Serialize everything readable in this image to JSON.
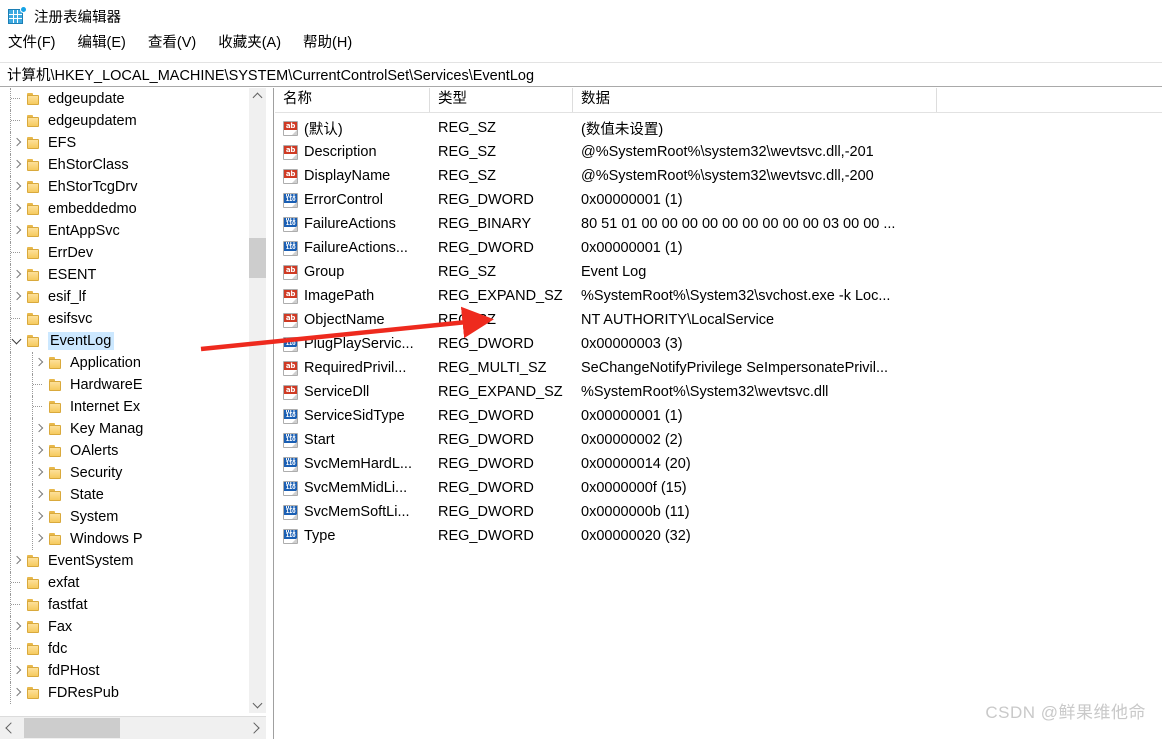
{
  "window": {
    "title": "注册表编辑器",
    "icon": "registry-editor-icon"
  },
  "menubar": {
    "items": [
      {
        "label": "文件(F)",
        "accel": "F"
      },
      {
        "label": "编辑(E)",
        "accel": "E"
      },
      {
        "label": "查看(V)",
        "accel": "V"
      },
      {
        "label": "收藏夹(A)",
        "accel": "A"
      },
      {
        "label": "帮助(H)",
        "accel": "H"
      }
    ]
  },
  "address": {
    "path": "计算机\\HKEY_LOCAL_MACHINE\\SYSTEM\\CurrentControlSet\\Services\\EventLog"
  },
  "tree": {
    "nodes": [
      {
        "label": "edgeupdate",
        "indent": 1,
        "state": "leaf",
        "selected": false
      },
      {
        "label": "edgeupdatem",
        "indent": 1,
        "state": "leaf",
        "selected": false
      },
      {
        "label": "EFS",
        "indent": 1,
        "state": "collapsed",
        "selected": false
      },
      {
        "label": "EhStorClass",
        "indent": 1,
        "state": "collapsed",
        "selected": false
      },
      {
        "label": "EhStorTcgDrv",
        "indent": 1,
        "state": "collapsed",
        "selected": false
      },
      {
        "label": "embeddedmo",
        "indent": 1,
        "state": "collapsed",
        "selected": false
      },
      {
        "label": "EntAppSvc",
        "indent": 1,
        "state": "collapsed",
        "selected": false
      },
      {
        "label": "ErrDev",
        "indent": 1,
        "state": "leaf",
        "selected": false
      },
      {
        "label": "ESENT",
        "indent": 1,
        "state": "collapsed",
        "selected": false
      },
      {
        "label": "esif_lf",
        "indent": 1,
        "state": "collapsed",
        "selected": false
      },
      {
        "label": "esifsvc",
        "indent": 1,
        "state": "leaf",
        "selected": false
      },
      {
        "label": "EventLog",
        "indent": 1,
        "state": "expanded",
        "selected": true
      },
      {
        "label": "Application",
        "indent": 2,
        "state": "collapsed",
        "selected": false
      },
      {
        "label": "HardwareE",
        "indent": 2,
        "state": "leaf",
        "selected": false
      },
      {
        "label": "Internet Ex",
        "indent": 2,
        "state": "leaf",
        "selected": false
      },
      {
        "label": "Key Manag",
        "indent": 2,
        "state": "collapsed",
        "selected": false
      },
      {
        "label": "OAlerts",
        "indent": 2,
        "state": "collapsed",
        "selected": false
      },
      {
        "label": "Security",
        "indent": 2,
        "state": "collapsed",
        "selected": false
      },
      {
        "label": "State",
        "indent": 2,
        "state": "collapsed",
        "selected": false
      },
      {
        "label": "System",
        "indent": 2,
        "state": "collapsed",
        "selected": false
      },
      {
        "label": "Windows P",
        "indent": 2,
        "state": "collapsed",
        "selected": false
      },
      {
        "label": "EventSystem",
        "indent": 1,
        "state": "collapsed",
        "selected": false
      },
      {
        "label": "exfat",
        "indent": 1,
        "state": "leaf",
        "selected": false
      },
      {
        "label": "fastfat",
        "indent": 1,
        "state": "leaf",
        "selected": false
      },
      {
        "label": "Fax",
        "indent": 1,
        "state": "collapsed",
        "selected": false
      },
      {
        "label": "fdc",
        "indent": 1,
        "state": "leaf",
        "selected": false
      },
      {
        "label": "fdPHost",
        "indent": 1,
        "state": "collapsed",
        "selected": false
      },
      {
        "label": "FDResPub",
        "indent": 1,
        "state": "collapsed",
        "selected": false
      }
    ]
  },
  "list": {
    "columns": [
      "名称",
      "类型",
      "数据"
    ],
    "rows": [
      {
        "icon": "string-value-icon",
        "name": "(默认)",
        "type": "REG_SZ",
        "data": "(数值未设置)"
      },
      {
        "icon": "string-value-icon",
        "name": "Description",
        "type": "REG_SZ",
        "data": "@%SystemRoot%\\system32\\wevtsvc.dll,-201"
      },
      {
        "icon": "string-value-icon",
        "name": "DisplayName",
        "type": "REG_SZ",
        "data": "@%SystemRoot%\\system32\\wevtsvc.dll,-200"
      },
      {
        "icon": "binary-value-icon",
        "name": "ErrorControl",
        "type": "REG_DWORD",
        "data": "0x00000001 (1)"
      },
      {
        "icon": "binary-value-icon",
        "name": "FailureActions",
        "type": "REG_BINARY",
        "data": "80 51 01 00 00 00 00 00 00 00 00 00 03 00 00 ..."
      },
      {
        "icon": "binary-value-icon",
        "name": "FailureActions...",
        "type": "REG_DWORD",
        "data": "0x00000001 (1)"
      },
      {
        "icon": "string-value-icon",
        "name": "Group",
        "type": "REG_SZ",
        "data": "Event Log"
      },
      {
        "icon": "string-value-icon",
        "name": "ImagePath",
        "type": "REG_EXPAND_SZ",
        "data": "%SystemRoot%\\System32\\svchost.exe -k Loc..."
      },
      {
        "icon": "string-value-icon",
        "name": "ObjectName",
        "type": "REG_SZ",
        "data": "NT AUTHORITY\\LocalService"
      },
      {
        "icon": "binary-value-icon",
        "name": "PlugPlayServic...",
        "type": "REG_DWORD",
        "data": "0x00000003 (3)"
      },
      {
        "icon": "string-value-icon",
        "name": "RequiredPrivil...",
        "type": "REG_MULTI_SZ",
        "data": "SeChangeNotifyPrivilege SeImpersonatePrivil..."
      },
      {
        "icon": "string-value-icon",
        "name": "ServiceDll",
        "type": "REG_EXPAND_SZ",
        "data": "%SystemRoot%\\System32\\wevtsvc.dll"
      },
      {
        "icon": "binary-value-icon",
        "name": "ServiceSidType",
        "type": "REG_DWORD",
        "data": "0x00000001 (1)"
      },
      {
        "icon": "binary-value-icon",
        "name": "Start",
        "type": "REG_DWORD",
        "data": "0x00000002 (2)"
      },
      {
        "icon": "binary-value-icon",
        "name": "SvcMemHardL...",
        "type": "REG_DWORD",
        "data": "0x00000014 (20)"
      },
      {
        "icon": "binary-value-icon",
        "name": "SvcMemMidLi...",
        "type": "REG_DWORD",
        "data": "0x0000000f (15)"
      },
      {
        "icon": "binary-value-icon",
        "name": "SvcMemSoftLi...",
        "type": "REG_DWORD",
        "data": "0x0000000b (11)"
      },
      {
        "icon": "binary-value-icon",
        "name": "Type",
        "type": "REG_DWORD",
        "data": "0x00000020 (32)"
      }
    ]
  },
  "annotation": {
    "color": "#ee2a1e",
    "shape": "arrow-pointing-right"
  },
  "watermark": {
    "text": "CSDN @鲜果维他命",
    "color": "#c9c9c9"
  }
}
